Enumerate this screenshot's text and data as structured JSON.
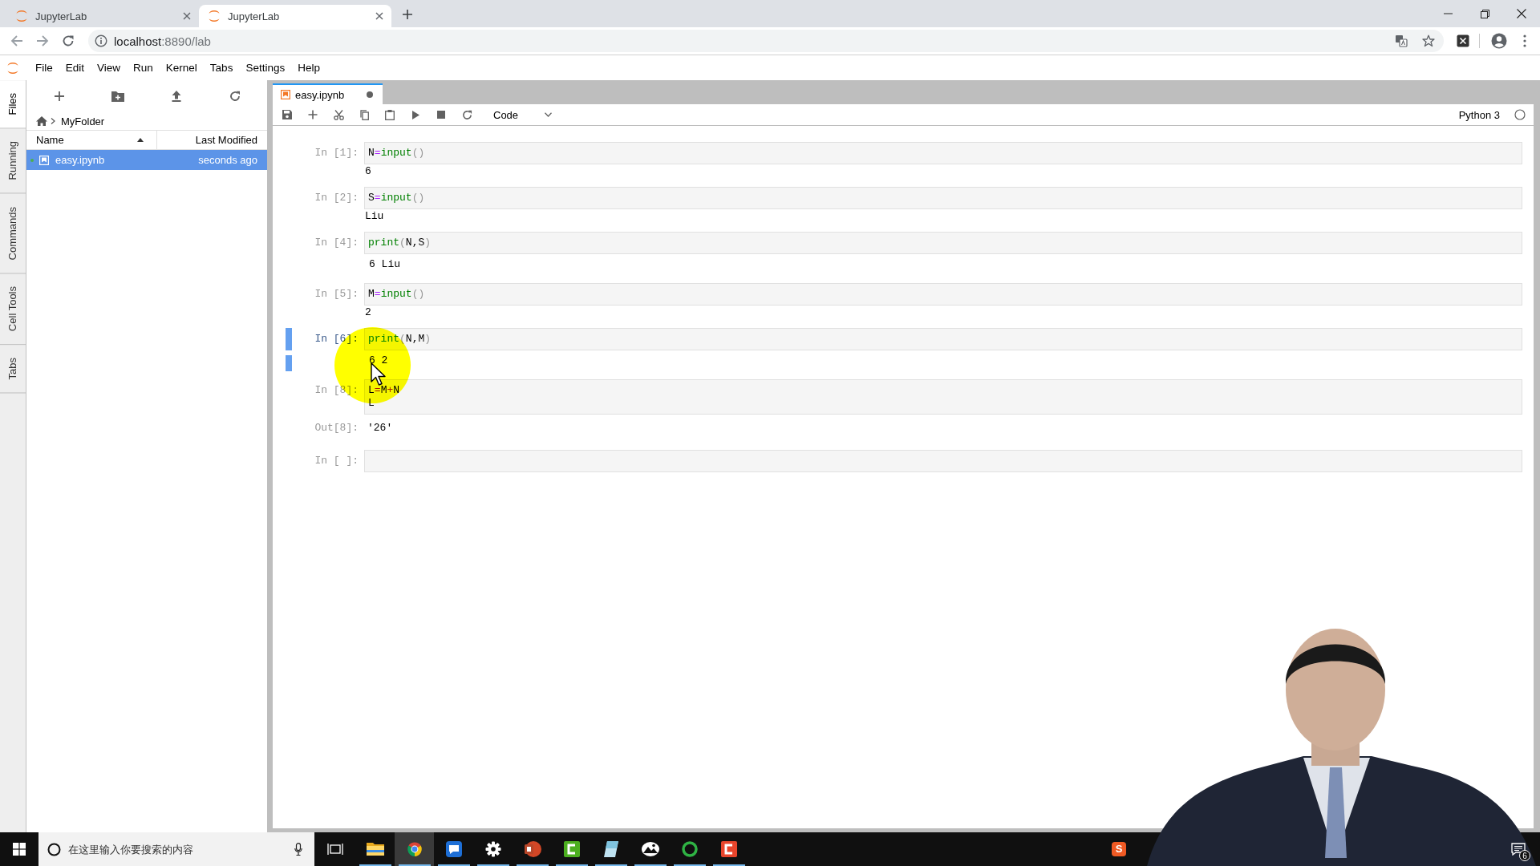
{
  "browser": {
    "tabs": [
      {
        "title": "JupyterLab",
        "selected": false
      },
      {
        "title": "JupyterLab",
        "selected": true
      }
    ],
    "address": "localhost:8890/lab"
  },
  "menu": [
    "File",
    "Edit",
    "View",
    "Run",
    "Kernel",
    "Tabs",
    "Settings",
    "Help"
  ],
  "side_tabs": [
    {
      "label": "Files",
      "selected": true
    },
    {
      "label": "Running",
      "selected": false
    },
    {
      "label": "Commands",
      "selected": false
    },
    {
      "label": "Cell Tools",
      "selected": false
    },
    {
      "label": "Tabs",
      "selected": false
    }
  ],
  "file_browser": {
    "breadcrumb": "MyFolder",
    "columns": [
      {
        "label": "Name",
        "sorted": true
      },
      {
        "label": "Last Modified",
        "sorted": false
      }
    ],
    "files": [
      {
        "name": "easy.ipynb",
        "modified": "seconds ago",
        "selected": true,
        "running": true
      }
    ]
  },
  "notebook": {
    "tab": {
      "title": "easy.ipynb",
      "selected": true,
      "dirty": true
    },
    "cell_type": "Code",
    "kernel": {
      "name": "Python 3",
      "busy": false
    },
    "cells": [
      {
        "prompt": "In [1]:",
        "selected": false,
        "source": [
          "N=input()"
        ],
        "outputs": [
          {
            "kind": "stdin",
            "text": "6"
          }
        ]
      },
      {
        "prompt": "In [2]:",
        "selected": false,
        "source": [
          "S=input()"
        ],
        "outputs": [
          {
            "kind": "stdin",
            "text": "Liu"
          }
        ]
      },
      {
        "prompt": "In [4]:",
        "selected": false,
        "source": [
          "print(N,S)"
        ],
        "outputs": [
          {
            "kind": "stream",
            "text": "6 Liu"
          }
        ]
      },
      {
        "prompt": "In [5]:",
        "selected": false,
        "source": [
          "M=input()"
        ],
        "outputs": [
          {
            "kind": "stdin",
            "text": "2"
          }
        ]
      },
      {
        "prompt": "In [6]:",
        "selected": true,
        "source": [
          "print(N,M)"
        ],
        "outputs": [
          {
            "kind": "stream",
            "text": "6 2"
          }
        ]
      },
      {
        "prompt": "In [8]:",
        "selected": false,
        "source": [
          "L=M+N",
          "L"
        ],
        "outputs": [
          {
            "kind": "result",
            "prompt": "Out[8]:",
            "text": "'26'"
          }
        ]
      },
      {
        "prompt": "In [ ]:",
        "selected": false
      }
    ]
  },
  "taskbar": {
    "search": {
      "placeholder": "在这里输入你要搜索的内容"
    },
    "apps": [
      {
        "kind": "folder",
        "running": true,
        "selected": false
      },
      {
        "kind": "browser",
        "running": true,
        "selected": true
      },
      {
        "kind": "chat",
        "running": true,
        "selected": false
      },
      {
        "kind": "gear",
        "running": true,
        "selected": false
      },
      {
        "kind": "slides",
        "running": true,
        "selected": false
      },
      {
        "kind": "recorder",
        "running": true,
        "selected": false
      },
      {
        "kind": "notes",
        "running": true,
        "selected": false
      },
      {
        "kind": "photos",
        "running": true,
        "selected": false
      },
      {
        "kind": "ring",
        "running": true,
        "selected": false
      },
      {
        "kind": "editor",
        "running": true,
        "selected": false
      }
    ],
    "tray": {
      "ime": "S",
      "notifications": "6"
    }
  }
}
